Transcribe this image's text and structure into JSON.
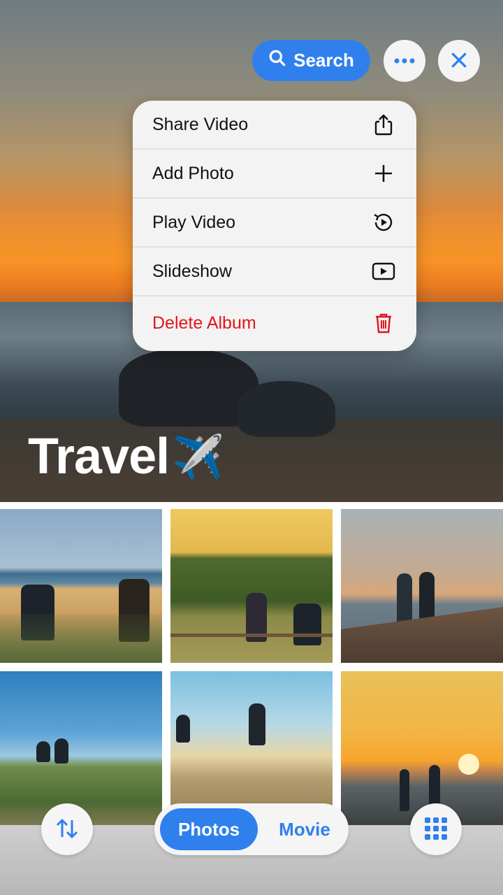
{
  "toolbar": {
    "search_label": "Search",
    "icons": {
      "search": "search-icon",
      "more": "more-horizontal-icon",
      "close": "close-icon"
    }
  },
  "menu": {
    "items": [
      {
        "label": "Share Video",
        "icon": "share-icon"
      },
      {
        "label": "Add Photo",
        "icon": "plus-icon"
      },
      {
        "label": "Play Video",
        "icon": "replay-icon"
      },
      {
        "label": "Slideshow",
        "icon": "play-rectangle-icon"
      },
      {
        "label": "Delete Album",
        "icon": "trash-icon",
        "color": "#e0161e"
      }
    ]
  },
  "album": {
    "title": "Travel",
    "emoji": "✈️"
  },
  "bottom": {
    "tabs": [
      {
        "label": "Photos",
        "selected": true
      },
      {
        "label": "Movie",
        "selected": false
      }
    ],
    "icons": {
      "sort": "sort-arrows-icon",
      "grid": "grid-icon"
    }
  },
  "colors": {
    "accent": "#2f80ed",
    "danger": "#e0161e",
    "menu_bg": "#f3f3f3"
  }
}
